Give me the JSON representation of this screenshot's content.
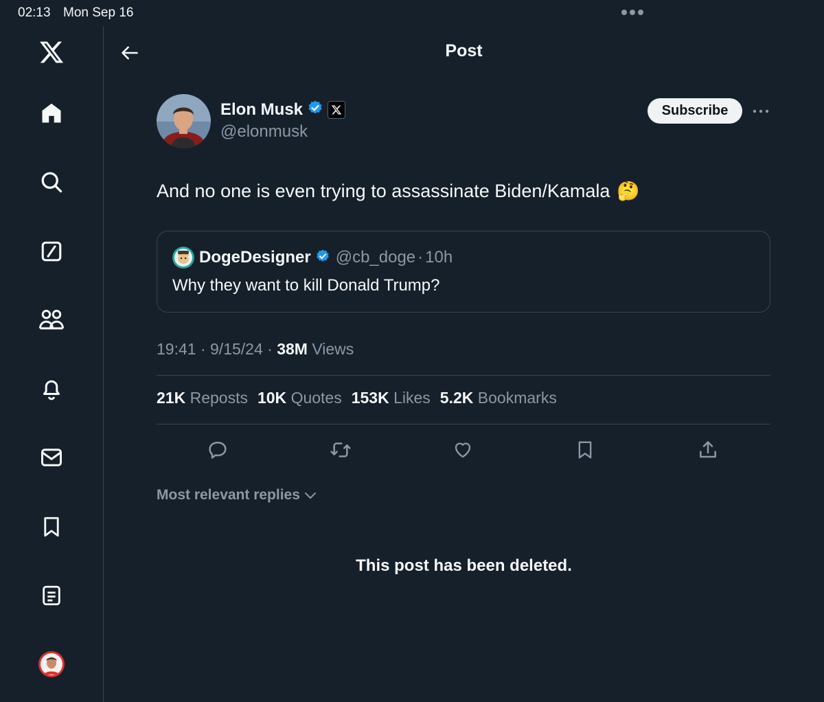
{
  "status_bar": {
    "time": "02:13",
    "date": "Mon Sep 16"
  },
  "sidebar": {
    "items": [
      {
        "name": "x-logo",
        "icon": "x-logo-icon"
      },
      {
        "name": "home",
        "icon": "home-icon"
      },
      {
        "name": "explore",
        "icon": "search-icon"
      },
      {
        "name": "grok",
        "icon": "grok-icon"
      },
      {
        "name": "communities",
        "icon": "communities-icon"
      },
      {
        "name": "notifications",
        "icon": "bell-icon"
      },
      {
        "name": "messages",
        "icon": "mail-icon"
      },
      {
        "name": "bookmarks",
        "icon": "bookmark-icon"
      },
      {
        "name": "lists",
        "icon": "list-icon"
      },
      {
        "name": "profile",
        "icon": "avatar-icon"
      }
    ]
  },
  "header": {
    "title": "Post"
  },
  "post": {
    "author_name": "Elon Musk",
    "author_handle": "@elonmusk",
    "subscribe_label": "Subscribe",
    "text": "And no one is even trying to assassinate Biden/Kamala",
    "emoji": "🤔",
    "quote": {
      "name": "DogeDesigner",
      "handle": "@cb_doge",
      "separator": "·",
      "time": "10h",
      "text": "Why they want to kill Donald Trump?"
    },
    "meta": {
      "time": "19:41",
      "separator": "·",
      "date": "9/15/24",
      "views_count": "38M",
      "views_label": "Views"
    },
    "stats": [
      {
        "count": "21K",
        "label": "Reposts"
      },
      {
        "count": "10K",
        "label": "Quotes"
      },
      {
        "count": "153K",
        "label": "Likes"
      },
      {
        "count": "5.2K",
        "label": "Bookmarks"
      }
    ],
    "actions": [
      "reply-icon",
      "repost-icon",
      "like-icon",
      "bookmark-icon",
      "share-icon"
    ]
  },
  "replies": {
    "sort_label": "Most relevant replies",
    "deleted_notice": "This post has been deleted."
  },
  "colors": {
    "background": "#15202b",
    "text_primary": "#f7f9f9",
    "text_secondary": "#8b98a5",
    "border": "#38444d",
    "verified": "#1d9bf0"
  }
}
